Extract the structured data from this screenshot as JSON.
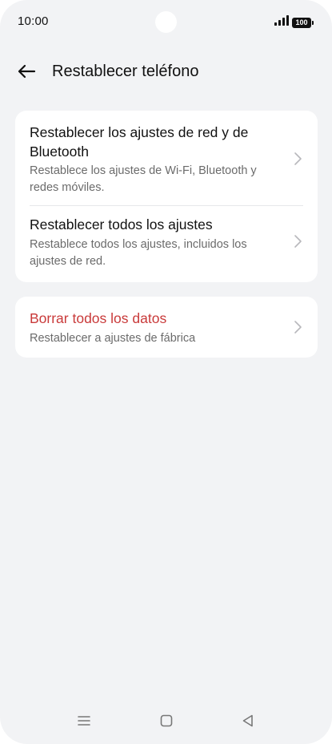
{
  "status_bar": {
    "time": "10:00",
    "battery": "100",
    "signal_icon": "signal-bars-icon"
  },
  "header": {
    "back_icon": "back-arrow-icon",
    "title": "Restablecer teléfono"
  },
  "groups": [
    {
      "items": [
        {
          "title": "Restablecer los ajustes de red y de Bluetooth",
          "subtitle": "Restablece los ajustes de Wi-Fi, Bluetooth y redes móviles."
        },
        {
          "title": "Restablecer todos los ajustes",
          "subtitle": "Restablece todos los ajustes, incluidos los ajustes de red."
        }
      ]
    },
    {
      "items": [
        {
          "title": "Borrar todos los datos",
          "subtitle": "Restablecer a ajustes de fábrica",
          "title_color": "#c93a3a"
        }
      ]
    }
  ],
  "nav_bar": {
    "menu_icon": "menu-icon",
    "home_icon": "home-square-icon",
    "back_icon": "back-triangle-icon"
  },
  "colors": {
    "background": "#f2f3f5",
    "card": "#ffffff",
    "danger": "#c93a3a",
    "secondary_text": "#6b6b6b"
  }
}
